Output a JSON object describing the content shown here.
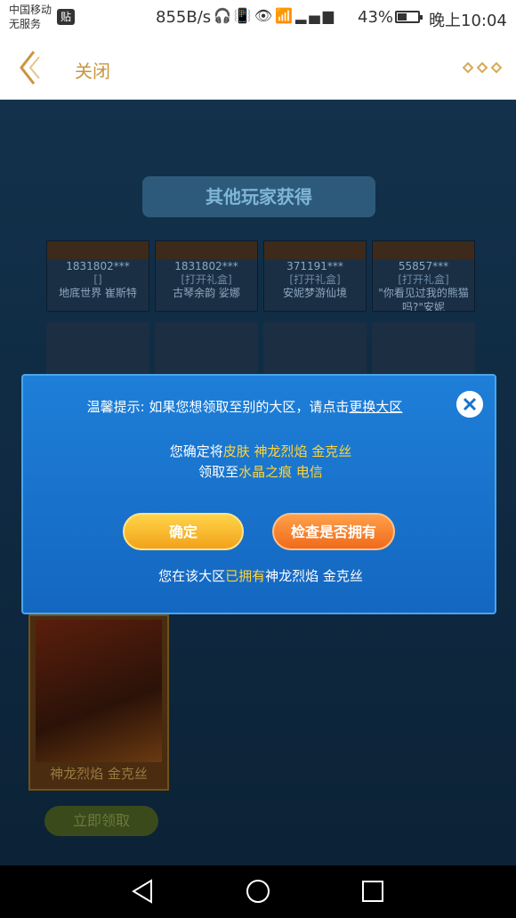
{
  "status_bar": {
    "carrier_line1": "中国移动",
    "carrier_line2": "无服务",
    "badge": "贴",
    "net_speed": "855B/s",
    "icons": [
      "headset-icon",
      "vibrate-icon",
      "eye-icon",
      "wifi-icon",
      "signal-4g-icon",
      "signal-icon"
    ],
    "battery": "43%",
    "time": "晚上10:04"
  },
  "header": {
    "close_label": "关闭"
  },
  "background": {
    "section_title": "其他玩家获得",
    "players": [
      {
        "id": "1831802***",
        "action": "[]",
        "skin": "地底世界 崔斯特"
      },
      {
        "id": "1831802***",
        "action": "[打开礼盒]",
        "skin": "古琴余韵 娑娜"
      },
      {
        "id": "371191***",
        "action": "[打开礼盒]",
        "skin": "安妮梦游仙境"
      },
      {
        "id": "55857***",
        "action": "[打开礼盒]",
        "skin": "\"你看见过我的熊猫吗?\"安妮"
      }
    ],
    "skin_card_name": "神龙烈焰 金克丝",
    "claim_button": "立即领取"
  },
  "modal": {
    "tip_prefix": "温馨提示: 如果您想领取至别的大区，请点击",
    "tip_link": "更换大区",
    "confirm_prefix": "您确定将",
    "confirm_item": "皮肤 神龙烈焰 金克丝",
    "receive_prefix": "领取至",
    "receive_target": "水晶之痕 电信",
    "ok_button": "确定",
    "check_button": "检查是否拥有",
    "own_prefix": "您在该大区",
    "own_status": "已拥有",
    "own_item": "神龙烈焰 金克丝"
  },
  "colors": {
    "accent_gold": "#c9953e",
    "modal_blue": "#1a73cc",
    "highlight_yellow": "#ffd43a"
  }
}
